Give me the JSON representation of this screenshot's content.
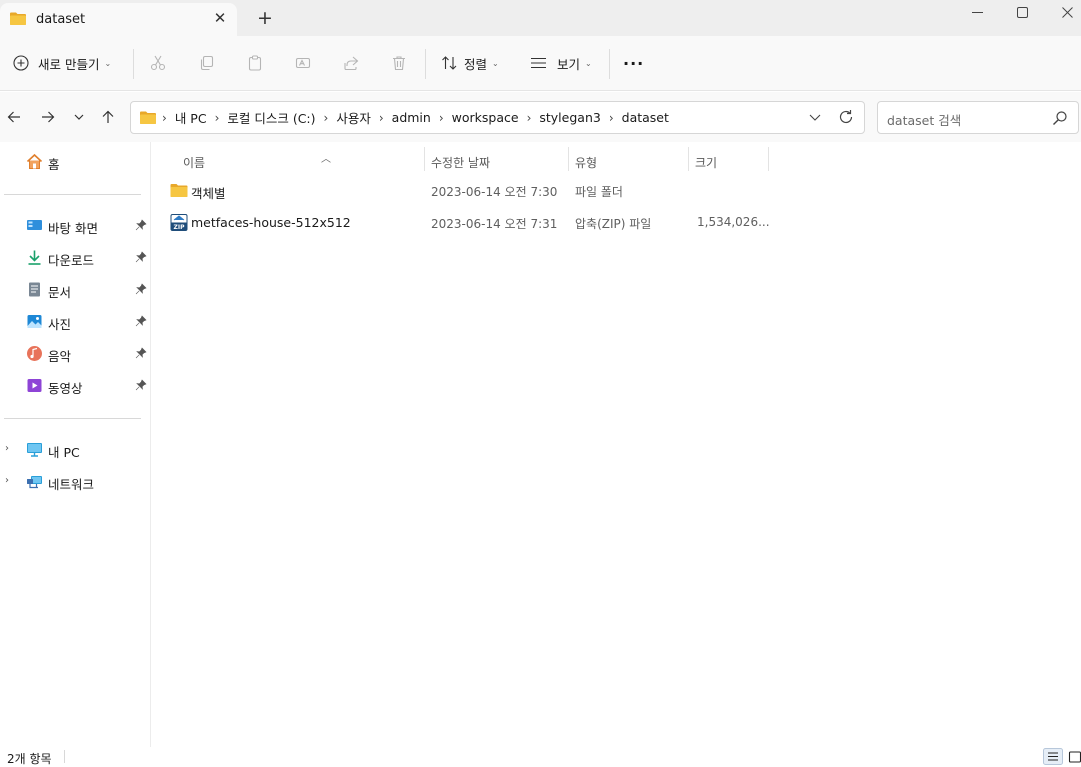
{
  "window": {
    "tab_title": "dataset",
    "new_tab_symbol": "+",
    "close_tab_symbol": "✕"
  },
  "toolbar": {
    "new_label": "새로 만들기",
    "sort_label": "정렬",
    "view_label": "보기",
    "more_symbol": "···",
    "icons": [
      "cut-icon",
      "copy-icon",
      "paste-icon",
      "rename-icon",
      "share-icon",
      "delete-icon"
    ]
  },
  "address": {
    "crumbs": [
      "내 PC",
      "로컬 디스크 (C:)",
      "사용자",
      "admin",
      "workspace",
      "stylegan3",
      "dataset"
    ]
  },
  "search": {
    "placeholder": "dataset 검색"
  },
  "sidebar": {
    "home": "홈",
    "quick_access": [
      {
        "label": "바탕 화면",
        "icon": "desktop-icon"
      },
      {
        "label": "다운로드",
        "icon": "download-icon"
      },
      {
        "label": "문서",
        "icon": "documents-icon"
      },
      {
        "label": "사진",
        "icon": "pictures-icon"
      },
      {
        "label": "음악",
        "icon": "music-icon"
      },
      {
        "label": "동영상",
        "icon": "videos-icon"
      }
    ],
    "this_pc": "내 PC",
    "network": "네트워크"
  },
  "columns": {
    "name": "이름",
    "modified": "수정한 날짜",
    "type": "유형",
    "size": "크기"
  },
  "files": [
    {
      "name": "객체별",
      "modified": "2023-06-14 오전 7:30",
      "type": "파일 폴더",
      "size": "",
      "icon": "folder-icon"
    },
    {
      "name": "metfaces-house-512x512",
      "modified": "2023-06-14 오전 7:31",
      "type": "압축(ZIP) 파일",
      "size": "1,534,026...",
      "icon": "zip-icon"
    }
  ],
  "status": {
    "item_count": "2개 항목"
  },
  "colors": {
    "folder": "#f4c542",
    "accent": "#0067c0"
  }
}
